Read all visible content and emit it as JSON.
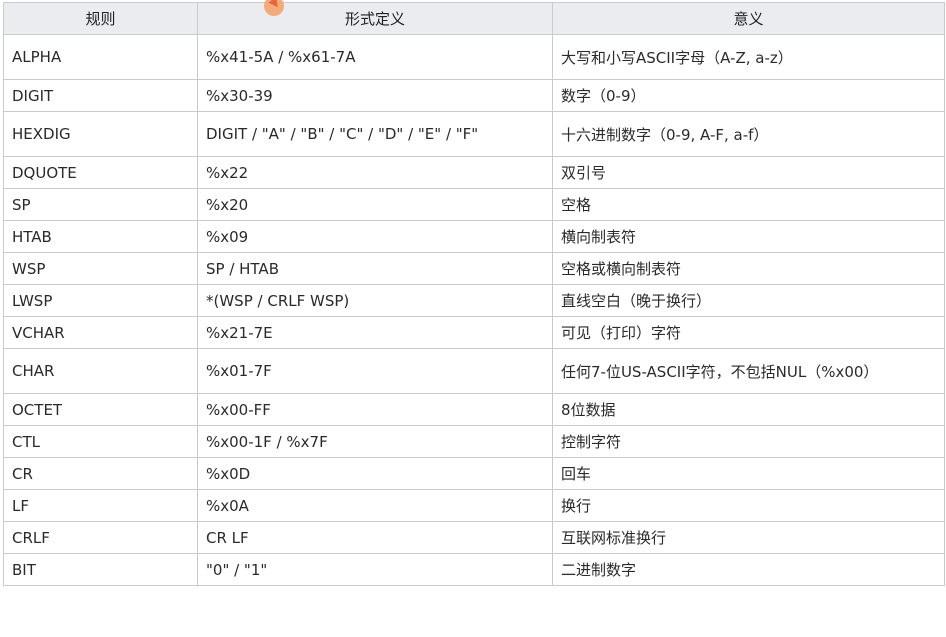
{
  "table": {
    "headers": [
      "规则",
      "形式定义",
      "意义"
    ],
    "rows": [
      {
        "rule": "ALPHA",
        "definition": "%x41-5A / %x61-7A",
        "meaning": "大写和小写ASCII字母（A-Z, a-z）"
      },
      {
        "rule": "DIGIT",
        "definition": "%x30-39",
        "meaning": "数字（0-9）"
      },
      {
        "rule": "HEXDIG",
        "definition": "DIGIT / \"A\" / \"B\" / \"C\" / \"D\" / \"E\" / \"F\"",
        "meaning": "十六进制数字（0-9, A-F, a-f）"
      },
      {
        "rule": "DQUOTE",
        "definition": "%x22",
        "meaning": "双引号"
      },
      {
        "rule": "SP",
        "definition": "%x20",
        "meaning": "空格"
      },
      {
        "rule": "HTAB",
        "definition": "%x09",
        "meaning": "横向制表符"
      },
      {
        "rule": "WSP",
        "definition": "SP / HTAB",
        "meaning": "空格或横向制表符"
      },
      {
        "rule": "LWSP",
        "definition": "*(WSP / CRLF WSP)",
        "meaning": "直线空白（晚于换行）"
      },
      {
        "rule": "VCHAR",
        "definition": "%x21-7E",
        "meaning": "可见（打印）字符"
      },
      {
        "rule": "CHAR",
        "definition": "%x01-7F",
        "meaning": "任何7-位US-ASCII字符，不包括NUL（%x00）"
      },
      {
        "rule": "OCTET",
        "definition": "%x00-FF",
        "meaning": "8位数据"
      },
      {
        "rule": "CTL",
        "definition": "%x00-1F / %x7F",
        "meaning": "控制字符"
      },
      {
        "rule": "CR",
        "definition": "%x0D",
        "meaning": "回车"
      },
      {
        "rule": "LF",
        "definition": "%x0A",
        "meaning": "换行"
      },
      {
        "rule": "CRLF",
        "definition": "CR LF",
        "meaning": "互联网标准换行"
      },
      {
        "rule": "BIT",
        "definition": "\"0\" / \"1\"",
        "meaning": "二进制数字"
      }
    ]
  },
  "colors": {
    "header_bg": "#eaecf0",
    "border": "#c8ccd1",
    "cursor": "#f4a66c"
  },
  "icons": {
    "cursor": "mouse-cursor-icon"
  }
}
